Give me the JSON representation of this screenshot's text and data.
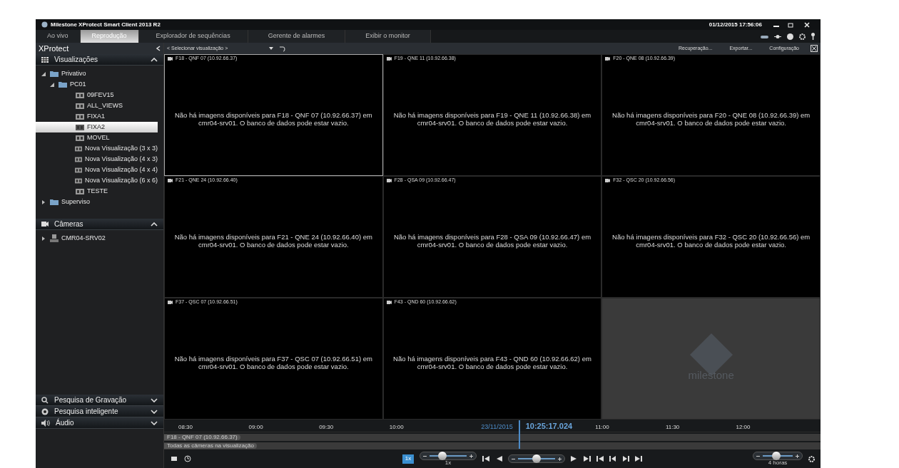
{
  "window": {
    "title": "Milestone XProtect Smart Client 2013 R2",
    "datetime": "01/12/2015 17:56:06"
  },
  "tabs": [
    {
      "label": "Ao vivo",
      "selected": false
    },
    {
      "label": "Reprodução",
      "selected": true
    },
    {
      "label": "Explorador de sequências",
      "selected": false
    },
    {
      "label": "Gerente de alarmes",
      "selected": false
    },
    {
      "label": "Exibir o monitor",
      "selected": false
    }
  ],
  "sidebar": {
    "title": "XProtect",
    "views_panel": {
      "title": "Visualizações",
      "expanded": true,
      "tree": [
        {
          "label": "Privativo",
          "kind": "folder",
          "expanded": true,
          "selected": false,
          "children": [
            {
              "label": "PC01",
              "kind": "folder",
              "expanded": true,
              "selected": false,
              "children": [
                {
                  "label": "09FEV15",
                  "kind": "view",
                  "selected": false
                },
                {
                  "label": "ALL_VIEWS",
                  "kind": "view",
                  "selected": false
                },
                {
                  "label": "FIXA1",
                  "kind": "view",
                  "selected": false
                },
                {
                  "label": "FIXA2",
                  "kind": "view",
                  "selected": true
                },
                {
                  "label": "MOVEL",
                  "kind": "view",
                  "selected": false
                },
                {
                  "label": "Nova Visualização (3 x 3)",
                  "kind": "view",
                  "selected": false
                },
                {
                  "label": "Nova Visualização (4 x 3)",
                  "kind": "view",
                  "selected": false
                },
                {
                  "label": "Nova Visualização (4 x 4)",
                  "kind": "view",
                  "selected": false
                },
                {
                  "label": "Nova Visualização (6 x 6)",
                  "kind": "view",
                  "selected": false
                },
                {
                  "label": "TESTE",
                  "kind": "view",
                  "selected": false
                }
              ]
            }
          ]
        },
        {
          "label": "Superviso",
          "kind": "folder",
          "expanded": false,
          "selected": false
        }
      ]
    },
    "cameras_panel": {
      "title": "Câmeras",
      "expanded": true,
      "tree": [
        {
          "label": "CMR04-SRV02",
          "kind": "server",
          "expanded": false,
          "selected": false
        }
      ]
    },
    "panels": [
      {
        "title": "Pesquisa de Gravação",
        "expanded": false,
        "kind": "search"
      },
      {
        "title": "Pesquisa inteligente",
        "expanded": false,
        "kind": "smart"
      },
      {
        "title": "Áudio",
        "expanded": false,
        "kind": "audio"
      }
    ]
  },
  "toolbar": {
    "view_selector": "< Selecionar visualização >",
    "actions": [
      "Recuperação...",
      "Exportar...",
      "Configuração"
    ]
  },
  "cameras": [
    {
      "kind": "camera",
      "title": "F18 - QNF 07 (10.92.66.37)",
      "selected": true,
      "message": "Não há imagens disponíveis para F18 - QNF 07 (10.92.66.37) em cmr04-srv01. O banco de dados pode estar vazio."
    },
    {
      "kind": "camera",
      "title": "F19 - QNE 11 (10.92.66.38)",
      "selected": false,
      "message": "Não há imagens disponíveis para F19 - QNE 11 (10.92.66.38) em cmr04-srv01. O banco de dados pode estar vazio."
    },
    {
      "kind": "camera",
      "title": "F20 - QNE 08 (10.92.66.39)",
      "selected": false,
      "message": "Não há imagens disponíveis para F20 - QNE 08 (10.92.66.39) em cmr04-srv01. O banco de dados pode estar vazio."
    },
    {
      "kind": "camera",
      "title": "F21 - QNE 24 (10.92.66.40)",
      "selected": false,
      "message": "Não há imagens disponíveis para F21 - QNE 24 (10.92.66.40) em cmr04-srv01. O banco de dados pode estar vazio."
    },
    {
      "kind": "camera",
      "title": "F28 - QSA 09 (10.92.66.47)",
      "selected": false,
      "message": "Não há imagens disponíveis para F28 - QSA 09 (10.92.66.47) em cmr04-srv01. O banco de dados pode estar vazio."
    },
    {
      "kind": "camera",
      "title": "F32 - QSC 20 (10.92.66.56)",
      "selected": false,
      "message": "Não há imagens disponíveis para F32 - QSC 20 (10.92.66.56) em cmr04-srv01. O banco de dados pode estar vazio."
    },
    {
      "kind": "camera",
      "title": "F37 - QSC 07 (10.92.66.51)",
      "selected": false,
      "message": "Não há imagens disponíveis para F37 - QSC 07 (10.92.66.51) em cmr04-srv01. O banco de dados pode estar vazio."
    },
    {
      "kind": "camera",
      "title": "F43 - QND 60 (10.92.66.62)",
      "selected": false,
      "message": "Não há imagens disponíveis para F43 - QND 60 (10.92.66.62) em cmr04-srv01. O banco de dados pode estar vazio."
    },
    {
      "kind": "logo",
      "logo_text": "milestone"
    }
  ],
  "timeline": {
    "ticks": [
      "08:30",
      "09:00",
      "09:30",
      "10:00",
      "11:00",
      "11:30",
      "12:00"
    ],
    "date": "23/11/2015",
    "time": "10:25:17.024",
    "tracks": [
      "F18 - QNF 07 (10.92.66.37)",
      "Todas as câmeras na visualização"
    ],
    "speed_button": "1x",
    "speed": {
      "level": 0.35,
      "reading": "1x"
    },
    "position": {
      "level": 0.5
    },
    "span": {
      "level": 0.45,
      "reading": "4 horas"
    }
  }
}
